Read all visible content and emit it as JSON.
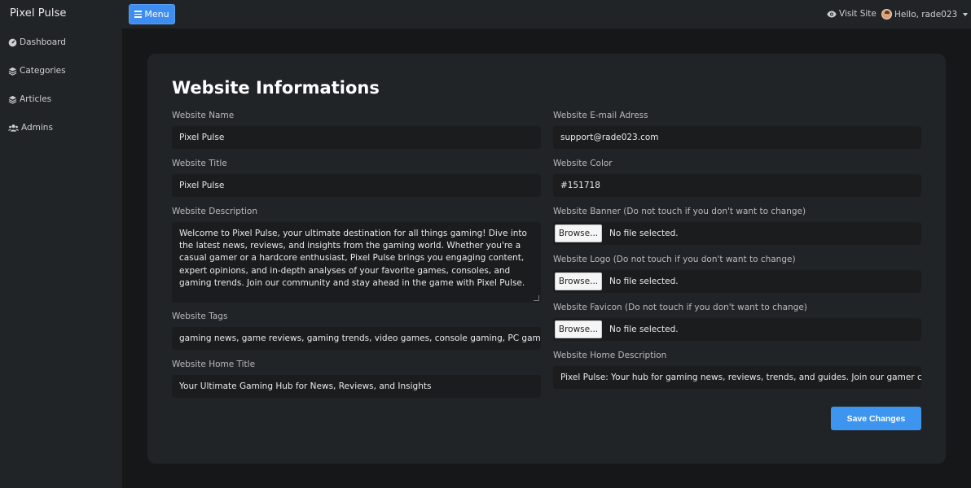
{
  "header": {
    "brand": "Pixel Pulse",
    "menu_label": "Menu",
    "visit_site_label": "Visit Site",
    "user_greeting": "Hello, rade023"
  },
  "sidebar": {
    "items": [
      {
        "label": "Dashboard",
        "icon": "dashboard-icon"
      },
      {
        "label": "Categories",
        "icon": "layers-icon"
      },
      {
        "label": "Articles",
        "icon": "layers-icon"
      },
      {
        "label": "Admins",
        "icon": "users-icon"
      }
    ]
  },
  "form": {
    "title": "Website Informations",
    "website_name": {
      "label": "Website Name",
      "value": "Pixel Pulse"
    },
    "website_title": {
      "label": "Website Title",
      "value": "Pixel Pulse"
    },
    "website_description": {
      "label": "Website Description",
      "value": "Welcome to Pixel Pulse, your ultimate destination for all things gaming! Dive into the latest news, reviews, and insights from the gaming world. Whether you're a casual gamer or a hardcore enthusiast, Pixel Pulse brings you engaging content, expert opinions, and in-depth analyses of your favorite games, consoles, and gaming trends. Join our community and stay ahead in the game with Pixel Pulse."
    },
    "website_tags": {
      "label": "Website Tags",
      "value": "gaming news, game reviews, gaming trends, video games, console gaming, PC gaming"
    },
    "website_home_title": {
      "label": "Website Home Title",
      "value": "Your Ultimate Gaming Hub for News, Reviews, and Insights"
    },
    "website_email": {
      "label": "Website E-mail Adress",
      "value": "support@rade023.com"
    },
    "website_color": {
      "label": "Website Color",
      "value": "#151718"
    },
    "website_banner": {
      "label": "Website Banner (Do not touch if you don't want to change)",
      "browse_label": "Browse...",
      "status": "No file selected."
    },
    "website_logo": {
      "label": "Website Logo (Do not touch if you don't want to change)",
      "browse_label": "Browse...",
      "status": "No file selected."
    },
    "website_favicon": {
      "label": "Website Favicon (Do not touch if you don't want to change)",
      "browse_label": "Browse...",
      "status": "No file selected."
    },
    "website_home_description": {
      "label": "Website Home Description",
      "value": "Pixel Pulse: Your hub for gaming news, reviews, trends, and guides. Join our gamer community"
    },
    "save_label": "Save Changes"
  },
  "colors": {
    "page_bg": "#151718",
    "panel_bg": "#212427",
    "input_bg": "#1a1c1e",
    "accent": "#3d95f0"
  }
}
